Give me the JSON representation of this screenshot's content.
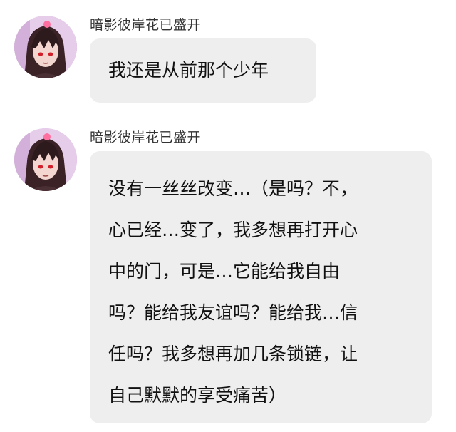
{
  "messages": [
    {
      "sender": "暗影彼岸花已盛开",
      "avatar_icon": "anime-girl-avatar-icon",
      "lines": [
        "我还是从前那个少年"
      ]
    },
    {
      "sender": "暗影彼岸花已盛开",
      "avatar_icon": "anime-girl-avatar-icon",
      "lines": [
        "没有一丝丝改变…（是吗？不，",
        "心已经…变了，我多想再打开心",
        "中的门，可是…它能给我自由",
        "吗？能给我友谊吗？能给我…信",
        "任吗？我多想再加几条锁链，让",
        "自己默默的享受痛苦）"
      ]
    }
  ],
  "colors": {
    "bubble_bg": "#eeeeee",
    "text": "#111111",
    "sender_text": "#333333",
    "avatar_bg": "#d9b8e0"
  }
}
